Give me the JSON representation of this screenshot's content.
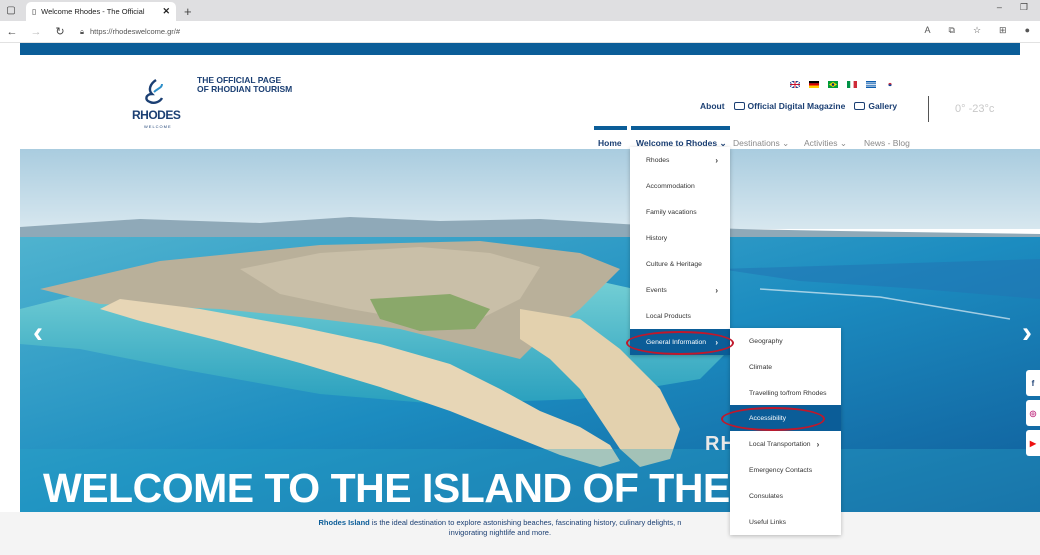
{
  "browser": {
    "tab_title": "Welcome Rhodes - The Official",
    "url": "https://rhodeswelcome.gr/#"
  },
  "header": {
    "tagline_line1": "THE OFFICIAL PAGE",
    "tagline_line2": "OF RHODIAN TOURISM",
    "logo_text": "RHODES",
    "logo_sub": "WELCOME",
    "top_links": {
      "about": "About",
      "magazine": "Official Digital Magazine",
      "gallery": "Gallery"
    },
    "weather": "0° -23°c"
  },
  "main_nav": {
    "home": "Home",
    "welcome": "Welcome to Rhodes",
    "destinations": "Destinations",
    "activities": "Activities",
    "news": "News - Blog"
  },
  "dropdown_welcome": [
    {
      "label": "Rhodes",
      "sub": true
    },
    {
      "label": "Accommodation",
      "sub": false
    },
    {
      "label": "Family vacations",
      "sub": false
    },
    {
      "label": "History",
      "sub": false
    },
    {
      "label": "Culture & Heritage",
      "sub": false
    },
    {
      "label": "Events",
      "sub": true
    },
    {
      "label": "Local Products",
      "sub": false
    },
    {
      "label": "General Information",
      "sub": true
    }
  ],
  "dropdown_general": [
    {
      "label": "Geography",
      "sub": false
    },
    {
      "label": "Climate",
      "sub": false
    },
    {
      "label": "Travelling to/from Rhodes",
      "sub": false
    },
    {
      "label": "Accessibility",
      "sub": false
    },
    {
      "label": "Local Transportation",
      "sub": true
    },
    {
      "label": "Emergency Contacts",
      "sub": false
    },
    {
      "label": "Consulates",
      "sub": false
    },
    {
      "label": "Useful Links",
      "sub": false
    }
  ],
  "hero": {
    "overlay_small": "RH",
    "title": "WELCOME TO THE ISLAND OF THE S"
  },
  "intro": {
    "highlight": "Rhodes Island",
    "line1": " is the ideal destination to explore astonishing beaches, fascinating history, culinary delights, n",
    "line2": "invigorating nightlife and more."
  },
  "colors": {
    "brand": "#0b5d98",
    "navy": "#1b3f73",
    "annotation": "#c0182b"
  }
}
